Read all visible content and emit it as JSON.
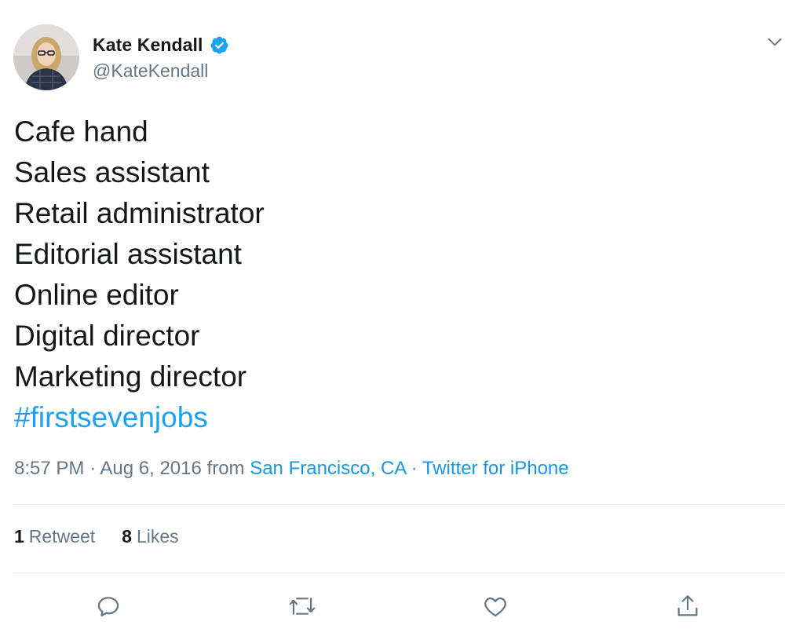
{
  "author": {
    "display_name": "Kate Kendall",
    "handle": "@KateKendall",
    "verified": true
  },
  "tweet": {
    "lines": [
      "Cafe hand",
      "Sales assistant",
      "Retail administrator",
      "Editorial assistant",
      "Online editor",
      "Digital director",
      "Marketing director"
    ],
    "hashtag": "#firstsevenjobs",
    "time": "8:57 PM",
    "separator": "·",
    "date": "Aug 6, 2016",
    "from_label": "from",
    "location": "San Francisco, CA",
    "source": "Twitter for iPhone"
  },
  "stats": {
    "retweets_count": "1",
    "retweets_label": "Retweet",
    "likes_count": "8",
    "likes_label": "Likes"
  },
  "icons": {
    "menu": "chevron-down-icon",
    "reply": "reply-icon",
    "retweet": "retweet-icon",
    "like": "heart-icon",
    "share": "share-icon",
    "verified": "verified-badge-icon"
  },
  "colors": {
    "text": "#14171a",
    "muted": "#657786",
    "link": "#1da1f2",
    "verified": "#1da1f2",
    "divider": "#e6ecf0"
  }
}
